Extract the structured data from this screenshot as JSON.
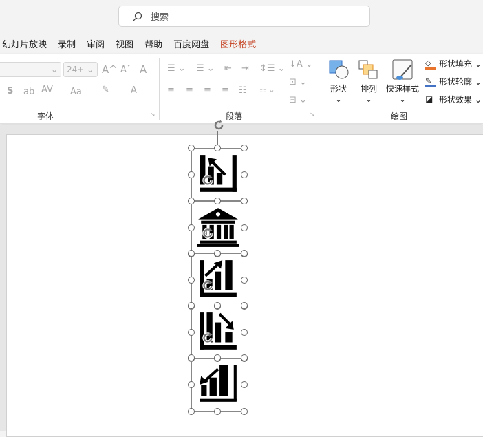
{
  "search": {
    "placeholder": "搜索"
  },
  "tabs": [
    "幻灯片放映",
    "录制",
    "审阅",
    "视图",
    "帮助",
    "百度网盘",
    "图形格式"
  ],
  "active_tab": "图形格式",
  "font_group": {
    "label": "字体",
    "size": "24+",
    "grow": "A^",
    "shrink": "Aˇ",
    "shadow": "S",
    "strike": "ab",
    "spacing": "AV",
    "case": "Aa",
    "font_color": "A"
  },
  "para_group": {
    "label": "段落"
  },
  "draw_group": {
    "label": "绘图",
    "shapes": "形状",
    "arrange": "排列",
    "quick_styles": "快速样式",
    "fill": "形状填充",
    "outline": "形状轮廓",
    "effects": "形状效果"
  },
  "colors": {
    "accent": "#c43e1c",
    "fill": "#e8742d",
    "outline": "#4472c4"
  },
  "slide_icons": [
    "chart-bar-arrow-up-left-icon",
    "bank-building-icon",
    "chart-bar-arrow-up-right-icon",
    "chart-bar-arrow-down-right-icon",
    "chart-bar-arrow-down-left-icon"
  ]
}
